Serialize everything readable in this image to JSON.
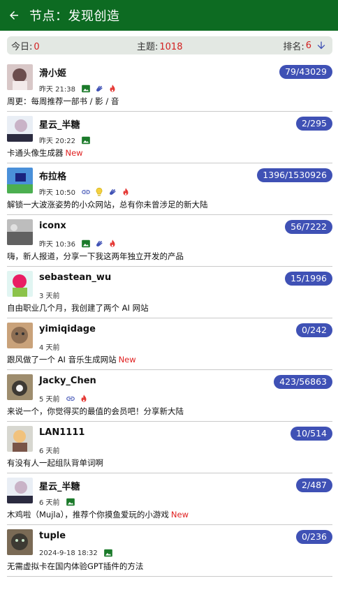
{
  "appbar": {
    "title": "节点：发现创造",
    "back_icon": "arrow-left-icon",
    "color": "#0d6b22"
  },
  "stats": {
    "today_label": "今日:",
    "today_value": "0",
    "topics_label": "主题:",
    "topics_value": "1018",
    "rank_label": "排名:",
    "rank_value": "6",
    "sort_icon": "arrow-down-icon"
  },
  "colors": {
    "badge": "#3f51b5",
    "new": "#e02020",
    "image_icon": "#1b7a2a",
    "link_icon": "#3f51b5",
    "fire_icon": "#e53935",
    "bulb_icon": "#f4d03f",
    "hand_icon": "#3f51b5"
  },
  "items": [
    {
      "user": "滑小姬",
      "time": "昨天 21:38",
      "count": "79/43029",
      "title": "周更：每周推荐一部书 / 影 / 音",
      "new": "",
      "icons": [
        "image",
        "hand",
        "fire"
      ]
    },
    {
      "user": "星云_半糖",
      "time": "昨天 20:22",
      "count": "2/295",
      "title": "卡通头像生成器",
      "new": "New",
      "icons": [
        "image"
      ]
    },
    {
      "user": "布拉格",
      "time": "昨天 10:50",
      "count": "1396/1530926",
      "title": "解锁一大波涨姿势的小众网站，总有你未曾涉足的新大陆",
      "new": "",
      "icons": [
        "link",
        "bulb",
        "hand",
        "fire"
      ]
    },
    {
      "user": "iconx",
      "time": "昨天 10:36",
      "count": "56/7222",
      "title": "嗨，新人报道，分享一下我这两年独立开发的产品",
      "new": "",
      "icons": [
        "image",
        "hand",
        "fire"
      ]
    },
    {
      "user": "sebastean_wu",
      "time": "3 天前",
      "count": "15/1996",
      "title": "自由职业几个月，我创建了两个 AI 网站",
      "new": "",
      "icons": []
    },
    {
      "user": "yimiqidage",
      "time": "4 天前",
      "count": "0/242",
      "title": "跟风做了一个 AI 音乐生成网站",
      "new": "New",
      "icons": []
    },
    {
      "user": "Jacky_Chen",
      "time": "5 天前",
      "count": "423/56863",
      "title": "来说一个，你觉得买的最值的会员吧！分享新大陆",
      "new": "",
      "icons": [
        "link",
        "fire"
      ]
    },
    {
      "user": "LAN1111",
      "time": "6 天前",
      "count": "10/514",
      "title": "有没有人一起组队背单词啊",
      "new": "",
      "icons": []
    },
    {
      "user": "星云_半糖",
      "time": "6 天前",
      "count": "2/487",
      "title": "木鸡啦（Mujla），推荐个你摸鱼爱玩的小游戏",
      "new": "New",
      "icons": [
        "image"
      ]
    },
    {
      "user": "tuple",
      "time": "2024-9-18 18:32",
      "count": "0/236",
      "title": "无需虚拟卡在国内体验GPT插件的方法",
      "new": "",
      "icons": [
        "image"
      ]
    }
  ]
}
